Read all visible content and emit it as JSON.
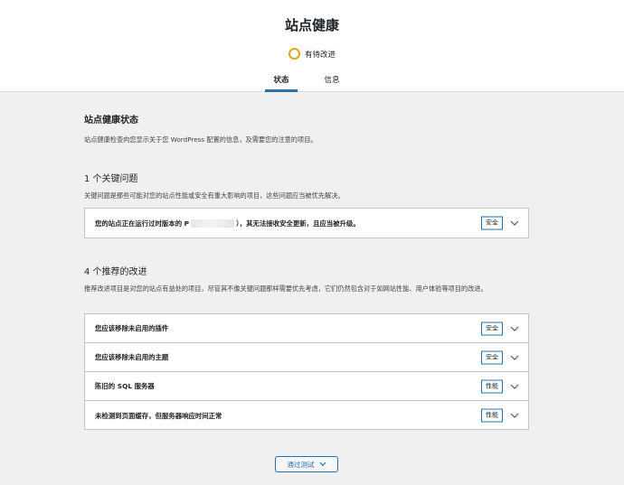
{
  "header": {
    "title": "站点健康",
    "status_label": "有待改进",
    "status_color": "#dba617",
    "tabs": [
      {
        "label": "状态",
        "active": true
      },
      {
        "label": "信息",
        "active": false
      }
    ],
    "accent_color": "#2271b1"
  },
  "main": {
    "heading": "站点健康状态",
    "description": "站点健康检查向您显示关于您 WordPress 配置的信息，及需要您的注意的项目。",
    "critical": {
      "heading": "1 个关键问题",
      "description": "关键问题是那些可能对您的站点性能或安全有重大影响的项目，这些问题应当被优先解决。",
      "items": [
        {
          "title_prefix": "您的站点正在运行过时版本的 P",
          "title_suffix": "），其无法接收安全更新，且应当被升级。",
          "badge": "安全",
          "icon": "chevron-down-icon"
        }
      ]
    },
    "recommended": {
      "heading": "4 个推荐的改进",
      "description": "推荐改进项目是对您的站点有益处的项目，尽管其不像关键问题那样需要优先考虑，它们仍然包含对于如网站性能、用户体验等项目的改进。",
      "items": [
        {
          "title": "您应该移除未启用的插件",
          "badge": "安全",
          "icon": "chevron-down-icon"
        },
        {
          "title": "您应该移除未启用的主题",
          "badge": "安全",
          "icon": "chevron-down-icon"
        },
        {
          "title": "陈旧的 SQL 服务器",
          "badge": "性能",
          "icon": "chevron-down-icon"
        },
        {
          "title": "未检测到页面缓存，但服务器响应时间正常",
          "badge": "性能",
          "icon": "chevron-down-icon"
        }
      ]
    },
    "passed_button": {
      "label": "通过测试",
      "icon": "chevron-down-icon"
    }
  }
}
